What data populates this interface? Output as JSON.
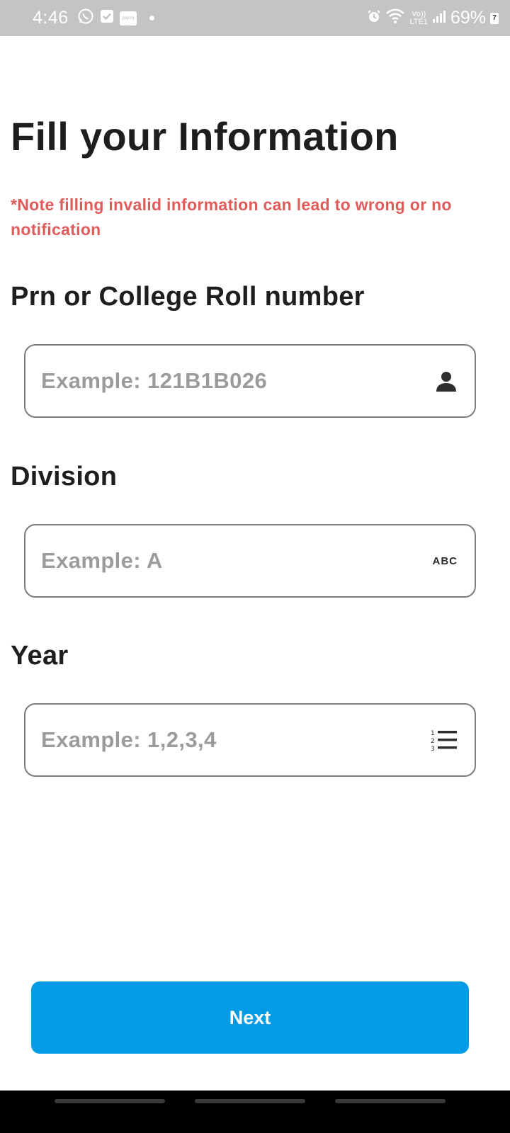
{
  "status_bar": {
    "time": "4:46",
    "lte_top": "Vo))",
    "lte_bottom": "LTE1",
    "battery_percent": "69%",
    "battery_badge": "7",
    "left_icons": [
      "whatsapp-icon",
      "check-square-icon",
      "paytm-icon",
      "dot-icon"
    ],
    "right_icons": [
      "alarm-icon",
      "wifi-icon",
      "signal-icon",
      "battery-icon"
    ]
  },
  "page": {
    "title": "Fill your Information",
    "note": "*Note filling invalid information can lead to wrong or no notification"
  },
  "form": {
    "prn": {
      "label": "Prn or College Roll number",
      "placeholder": "Example: 121B1B026",
      "value": "",
      "icon": "person-icon"
    },
    "division": {
      "label": "Division",
      "placeholder": "Example: A",
      "value": "",
      "icon": "abc-icon",
      "icon_text": "ABC"
    },
    "year": {
      "label": "Year",
      "placeholder": "Example: 1,2,3,4",
      "value": "",
      "icon": "numbered-list-icon"
    }
  },
  "actions": {
    "next_label": "Next"
  },
  "colors": {
    "status_bar": "#c4c4c4",
    "note_text": "#e15a5a",
    "button": "#039be5",
    "field_border": "#7c7c7c",
    "placeholder": "#9b9b9b"
  }
}
